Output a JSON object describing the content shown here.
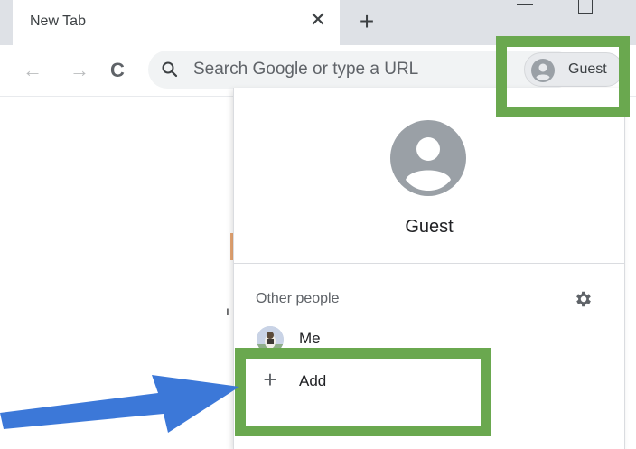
{
  "tab": {
    "title": "New Tab",
    "close_icon": "close-icon",
    "new_tab_icon": "plus-icon"
  },
  "toolbar": {
    "back_icon": "back-arrow-icon",
    "forward_icon": "forward-arrow-icon",
    "reload_icon": "reload-icon",
    "omnibox_placeholder": "Search Google or type a URL",
    "profile_label": "Guest"
  },
  "profile_menu": {
    "current_name": "Guest",
    "section_label": "Other people",
    "people": [
      {
        "name": "Me"
      }
    ],
    "add_label": "Add"
  },
  "colors": {
    "highlight": "#6aa84f",
    "arrow": "#3c78d8",
    "tabstrip": "#dee1e6",
    "omnibox": "#f1f3f4"
  }
}
